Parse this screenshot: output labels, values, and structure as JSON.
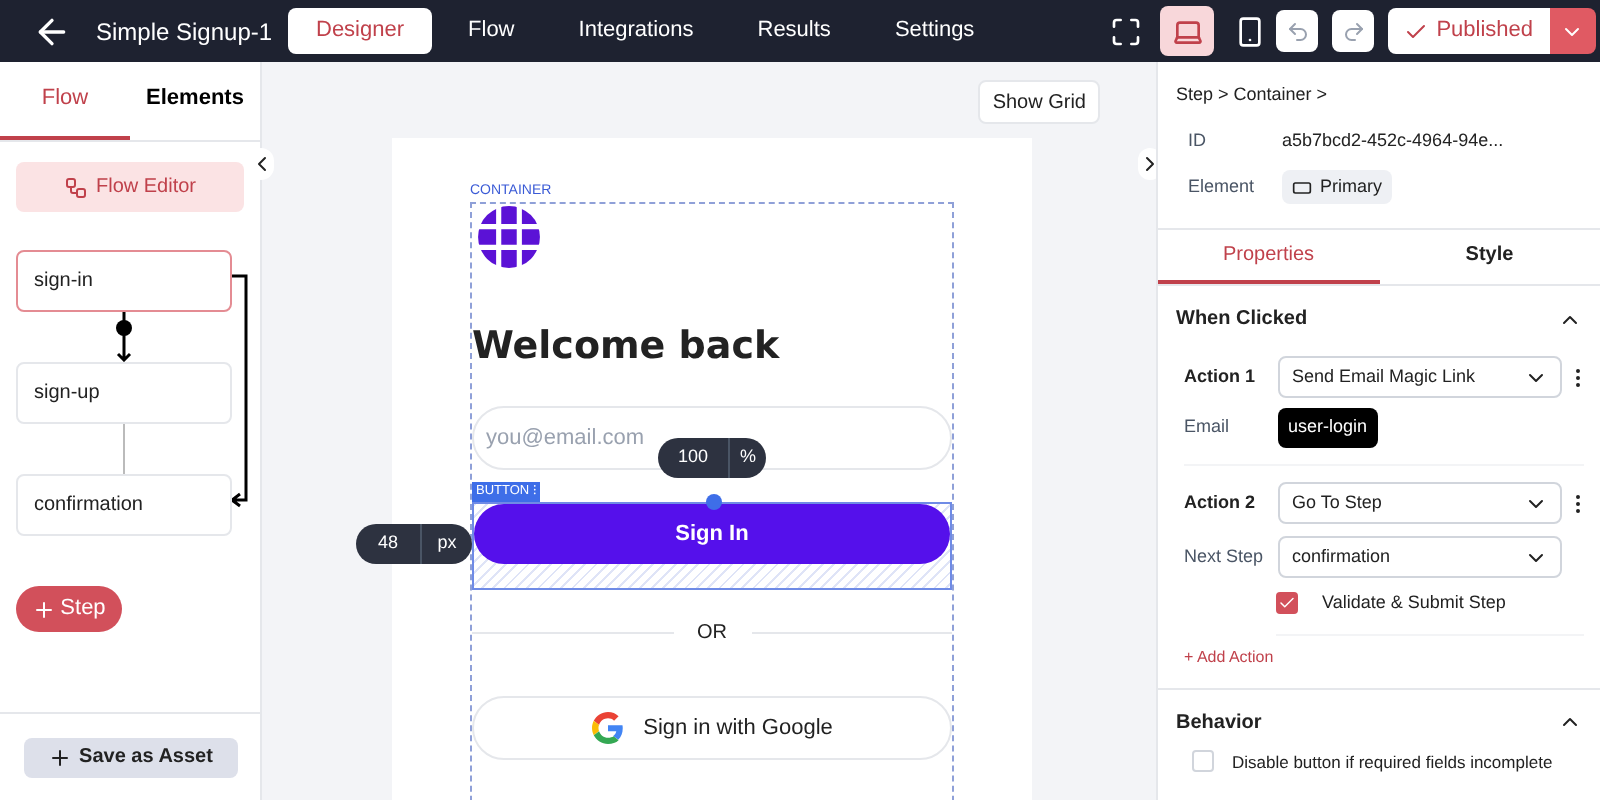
{
  "topbar": {
    "title": "Simple Signup-1",
    "tabs": [
      {
        "label": "Designer",
        "selected": true
      },
      {
        "label": "Flow",
        "selected": false
      },
      {
        "label": "Integrations",
        "selected": false
      },
      {
        "label": "Results",
        "selected": false
      },
      {
        "label": "Settings",
        "selected": false
      }
    ],
    "devices": [
      {
        "kind": "fullscreen",
        "selected": false
      },
      {
        "kind": "laptop",
        "selected": true
      },
      {
        "kind": "phone",
        "selected": false
      }
    ],
    "publish": {
      "label": "Published"
    }
  },
  "left_panel": {
    "tabs": [
      {
        "label": "Flow",
        "selected": true
      },
      {
        "label": "Elements",
        "selected": false
      }
    ],
    "flow_editor": "Flow Editor",
    "steps": [
      {
        "label": "sign-in",
        "selected": true
      },
      {
        "label": "sign-up",
        "selected": false
      },
      {
        "label": "confirmation",
        "selected": false
      }
    ],
    "add_step": "Step",
    "save_asset": "Save as Asset"
  },
  "canvas": {
    "show_grid": "Show Grid",
    "container_label": "CONTAINER",
    "heading": "Welcome back",
    "email": {
      "placeholder": "you@email.com"
    },
    "width_badge": {
      "value": "100",
      "unit": "%"
    },
    "button_label": "BUTTON",
    "button_menu": "⁝",
    "primary_button": "Sign In",
    "height_badge": {
      "value": "48",
      "unit": "px"
    },
    "divider": "OR",
    "google_button": "Sign in with Google"
  },
  "right_panel": {
    "breadcrumb": "Step > Container >",
    "id_label": "ID",
    "id_value": "a5b7bcd2-452c-4964-94e...",
    "element_label": "Element",
    "element_value": "Primary",
    "tabs": [
      {
        "label": "Properties",
        "selected": true
      },
      {
        "label": "Style",
        "selected": false
      }
    ],
    "when_clicked": {
      "title": "When Clicked",
      "expanded": true,
      "action1_label": "Action 1",
      "action1_value": "Send Email Magic Link",
      "email_label": "Email",
      "email_value": "user-login",
      "action2_label": "Action 2",
      "action2_value": "Go To Step",
      "next_step_label": "Next Step",
      "next_step_value": "confirmation",
      "validate": {
        "label": "Validate & Submit Step",
        "checked": true
      },
      "add_action": "+ Add Action"
    },
    "behavior": {
      "title": "Behavior",
      "expanded": true,
      "disable": {
        "label": "Disable button if required fields incomplete",
        "checked": false
      }
    }
  }
}
